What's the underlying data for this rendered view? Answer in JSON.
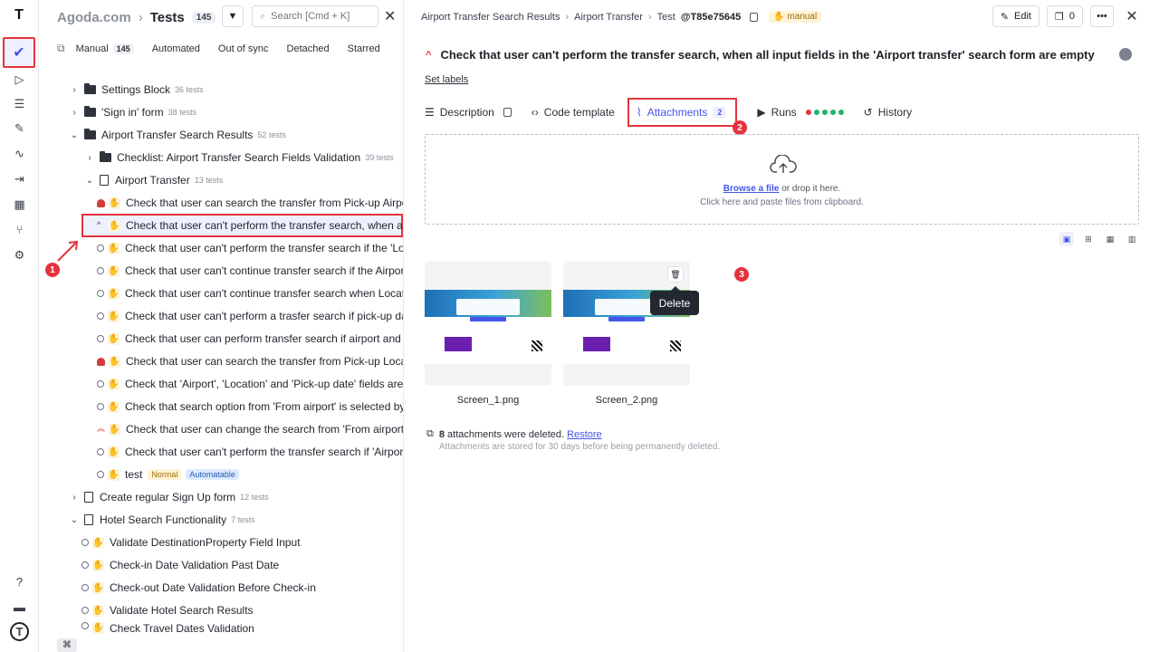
{
  "rail": {
    "logo": "T"
  },
  "tree": {
    "site": "Agoda.com",
    "section": "Tests",
    "count": "145",
    "search_placeholder": "Search [Cmd + K]",
    "tabs": [
      {
        "label": "Manual",
        "count": "145"
      },
      {
        "label": "Automated"
      },
      {
        "label": "Out of sync"
      },
      {
        "label": "Detached"
      },
      {
        "label": "Starred"
      }
    ],
    "rows": [
      {
        "label": "Settings Block",
        "meta": "36 tests"
      },
      {
        "label": "'Sign in' form",
        "meta": "38 tests"
      },
      {
        "label": "Airport Transfer Search Results",
        "meta": "52 tests"
      },
      {
        "label": "Checklist: Airport Transfer Search Fields Validation",
        "meta": "39 tests"
      },
      {
        "label": "Airport Transfer",
        "meta": "13 tests"
      },
      {
        "label": "Check that user can search the transfer from Pick-up Airpo"
      },
      {
        "label": "Check that user can't perform the transfer search, when al"
      },
      {
        "label": "Check that user can't perform the transfer search if the 'Lo"
      },
      {
        "label": "Check that user can't continue transfer search if the Airpor"
      },
      {
        "label": "Check that user can't continue transfer search when Locat"
      },
      {
        "label": "Check that user can't perform a trasfer search if pick-up da"
      },
      {
        "label": "Check that user can perform transfer search if airport and l"
      },
      {
        "label": "Check that user can search the transfer from Pick-up Locat"
      },
      {
        "label": "Check that 'Airport', 'Location' and 'Pick-up date' fields are"
      },
      {
        "label": "Check that search option from 'From airport' is selected by"
      },
      {
        "label": "Check that user can change the search from 'From airport'"
      },
      {
        "label": "Check that user can't perform the transfer search if 'Airpor"
      },
      {
        "label": "test",
        "tag1": "Normal",
        "tag2": "Automatable"
      },
      {
        "label": "Create regular Sign Up form",
        "meta": "12 tests"
      },
      {
        "label": "Hotel Search Functionality",
        "meta": "7 tests"
      },
      {
        "label": "Validate DestinationProperty Field Input"
      },
      {
        "label": "Check-in Date Validation Past Date"
      },
      {
        "label": "Check-out Date Validation Before Check-in"
      },
      {
        "label": "Validate Hotel Search Results"
      },
      {
        "label": "Check Travel Dates Validation"
      }
    ],
    "cmd_key": "⌘"
  },
  "detail": {
    "crumbs": [
      "Airport Transfer Search Results",
      "Airport Transfer"
    ],
    "test_prefix": "Test",
    "test_id": "@T85e75645",
    "manual_tag": "manual",
    "edit_label": "Edit",
    "comments_count": "0",
    "title": "Check that user can't perform the transfer search, when all input fields in the 'Airport transfer' search form are empty",
    "set_labels": "Set labels",
    "tabs": {
      "description": "Description",
      "code_template": "Code template",
      "attachments": "Attachments",
      "attachments_count": "2",
      "runs": "Runs",
      "history": "History"
    },
    "dropzone": {
      "browse": "Browse a file",
      "or_drop": "or drop it here.",
      "clipboard": "Click here and paste files from clipboard."
    },
    "attachments": [
      {
        "name": "Screen_1.png"
      },
      {
        "name": "Screen_2.png"
      }
    ],
    "tooltip": "Delete",
    "deleted_count": "8",
    "deleted_text": "attachments were deleted.",
    "restore": "Restore",
    "retention_note": "Attachments are stored for 30 days before being permanently deleted."
  },
  "callouts": [
    "1",
    "2",
    "3"
  ],
  "colors": {
    "accent": "#4356e8",
    "highlight": "#e5333d",
    "pass": "#20b46b"
  }
}
